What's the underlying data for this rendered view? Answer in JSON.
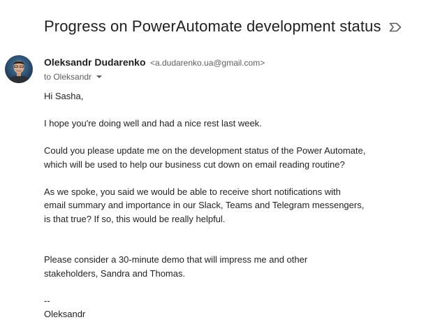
{
  "email": {
    "subject": "Progress on PowerAutomate development status",
    "label_icon": "label-arrow-icon",
    "sender": {
      "name": "Oleksandr Dudarenko",
      "email": "<a.dudarenko.ua@gmail.com>",
      "avatar": "avatar-photo"
    },
    "recipient_line": "to Oleksandr",
    "body": {
      "greeting": "Hi Sasha,",
      "p1": "I hope you're doing well and had a nice rest last week.",
      "p2_line1": "Could you please update me on the development status of the Power Automate,",
      "p2_line2": "which will be used to help our business cut down on email reading routine?",
      "p3_line1": "As we spoke, you said we would be able to receive short notifications with",
      "p3_line2": "email summary and importance in our Slack, Teams and Telegram messengers,",
      "p3_line3": "is that true? If so, this would be really helpful.",
      "p4_line1": "Please consider a 30-minute demo that will impress me and other",
      "p4_line2": "stakeholders, Sandra and Thomas.",
      "sig_dash": "--",
      "signature": "Oleksandr"
    }
  }
}
